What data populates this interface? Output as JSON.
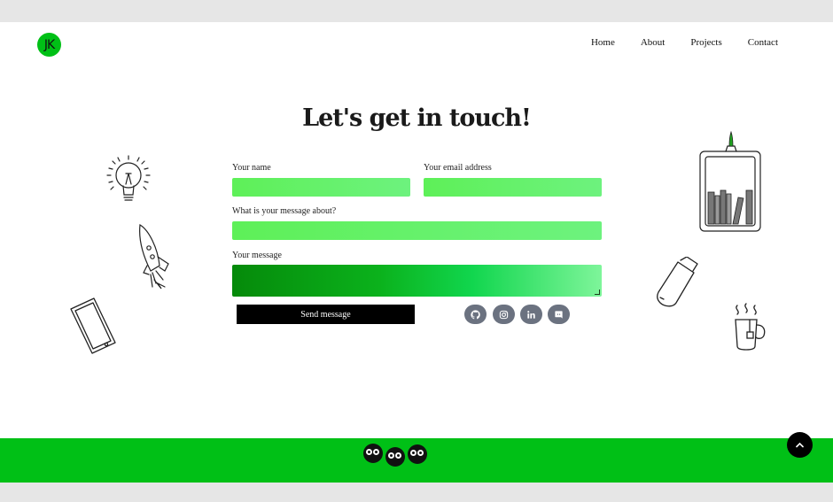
{
  "header": {
    "logo_text": "JK",
    "nav": [
      "Home",
      "About",
      "Projects",
      "Contact"
    ]
  },
  "main": {
    "title": "Let's get in touch!",
    "form": {
      "name_label": "Your name",
      "email_label": "Your email address",
      "subject_label": "What is your message about?",
      "message_label": "Your message",
      "submit_label": "Send message"
    },
    "social_icons": [
      "github-icon",
      "instagram-icon",
      "linkedin-icon",
      "discord-icon"
    ]
  },
  "doodles": [
    "lightbulb",
    "rocket",
    "smartphone",
    "bookshelf",
    "usb-drive",
    "coffee-mug"
  ],
  "footer": {
    "mascots": [
      "soot-sprite",
      "soot-sprite",
      "soot-sprite"
    ],
    "scroll_top_icon": "chevron-up-icon"
  },
  "colors": {
    "accent_green": "#00c016",
    "field_green": "#5ef058",
    "button_black": "#000000",
    "social_gray": "#6b7280"
  }
}
